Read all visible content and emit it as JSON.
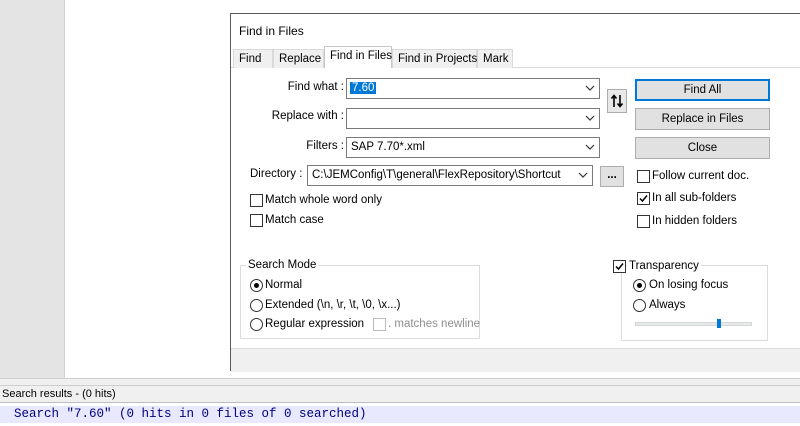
{
  "dialog": {
    "title": "Find in Files",
    "tabs": [
      "Find",
      "Replace",
      "Find in Files",
      "Find in Projects",
      "Mark"
    ],
    "active_tab": "Find in Files",
    "find_what": {
      "label": "Find what :",
      "value": "7.60"
    },
    "replace_with": {
      "label": "Replace with :",
      "value": ""
    },
    "filters": {
      "label": "Filters :",
      "value": "SAP 7.70*.xml"
    },
    "directory": {
      "label": "Directory :",
      "value": "C:\\JEMConfig\\T\\general\\FlexRepository\\Shortcut",
      "browse_label": "..."
    },
    "swap_icon": "swap-arrows-icon",
    "buttons": {
      "find_all": "Find All",
      "replace_in_files": "Replace in Files",
      "close": "Close"
    },
    "options": {
      "match_whole_word": {
        "label": "Match whole word only",
        "checked": false
      },
      "match_case": {
        "label": "Match case",
        "checked": false
      },
      "follow_current_doc": {
        "label": "Follow current doc.",
        "checked": false
      },
      "in_all_subfolders": {
        "label": "In all sub-folders",
        "checked": true
      },
      "in_hidden_folders": {
        "label": "In hidden folders",
        "checked": false
      }
    },
    "search_mode": {
      "title": "Search Mode",
      "normal": "Normal",
      "extended": "Extended (\\n, \\r, \\t, \\0, \\x...)",
      "regex": "Regular expression",
      "matches_newline": ". matches newline",
      "selected": "Normal"
    },
    "transparency": {
      "title": "Transparency",
      "checked": true,
      "on_losing_focus": "On losing focus",
      "always": "Always",
      "selected": "On losing focus",
      "level": 0.75
    }
  },
  "results": {
    "header": "Search results - (0 hits)",
    "line": "Search \"7.60\" (0 hits in 0 files of 0 searched)"
  },
  "colors": {
    "accent": "#0078d7",
    "result_text": "#000080",
    "result_bg": "#e8e8ff"
  }
}
